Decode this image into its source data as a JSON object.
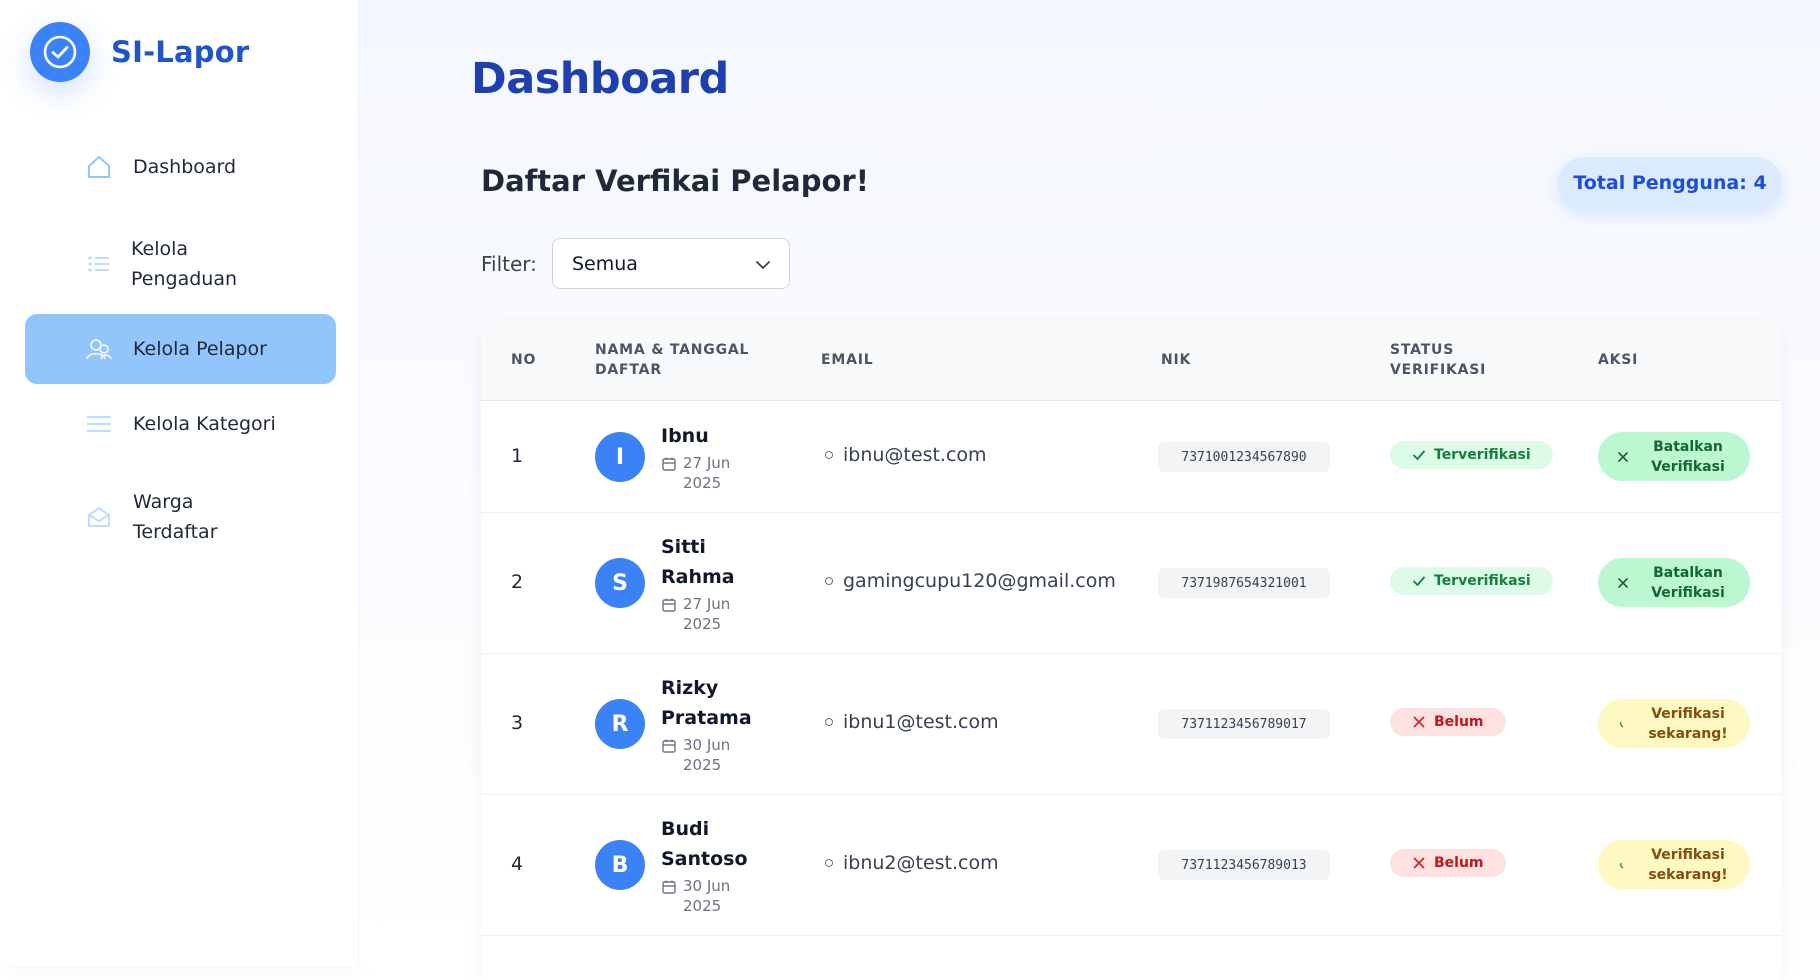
{
  "app": {
    "name": "SI-Lapor"
  },
  "sidebar": {
    "items": [
      {
        "label": "Dashboard",
        "icon": "home-icon",
        "active": false
      },
      {
        "label": "Kelola\nPengaduan",
        "icon": "list-icon",
        "active": false
      },
      {
        "label": "Kelola Pelapor",
        "icon": "users-icon",
        "active": true
      },
      {
        "label": "Kelola Kategori",
        "icon": "menu-icon",
        "active": false
      },
      {
        "label": "Warga\nTerdaftar",
        "icon": "mail-open-icon",
        "active": false
      }
    ]
  },
  "main": {
    "page_title": "Dashboard",
    "section_title": "Daftar Verfikai Pelapor!",
    "total_badge": "Total Pengguna: 4",
    "filter": {
      "label": "Filter:",
      "value": "Semua"
    },
    "table": {
      "headers": {
        "no": "NO",
        "name": "NAMA & TANGGAL\nDAFTAR",
        "email": "EMAIL",
        "nik": "NIK",
        "status": "STATUS\nVERIFIKASI",
        "action": "AKSI"
      },
      "rows": [
        {
          "no": "1",
          "initial": "I",
          "name": "Ibnu",
          "date": "27 Jun\n2025",
          "email": "ibnu@test.com",
          "nik": "7371001234567890",
          "status": "Terverifikasi",
          "verified": true,
          "action": "Batalkan\nVerifikasi"
        },
        {
          "no": "2",
          "initial": "S",
          "name": "Sitti\nRahma",
          "date": "27 Jun\n2025",
          "email": "gamingcupu120@gmail.com",
          "nik": "7371987654321001",
          "status": "Terverifikasi",
          "verified": true,
          "action": "Batalkan\nVerifikasi"
        },
        {
          "no": "3",
          "initial": "R",
          "name": "Rizky\nPratama",
          "date": "30 Jun\n2025",
          "email": "ibnu1@test.com",
          "nik": "7371123456789017",
          "status": "Belum",
          "verified": false,
          "action": "Verifikasi\nsekarang!"
        },
        {
          "no": "4",
          "initial": "B",
          "name": "Budi\nSantoso",
          "date": "30 Jun\n2025",
          "email": "ibnu2@test.com",
          "nik": "7371123456789013",
          "status": "Belum",
          "verified": false,
          "action": "Verifikasi\nsekarang!"
        }
      ]
    }
  },
  "colors": {
    "brand": "#3b82f6",
    "title": "#1e40af",
    "active_nav": "#93c5fd",
    "verified": "#dcfce7",
    "unverified": "#fee2e2",
    "cancel_action": "#bbf7d0",
    "verify_action": "#fef9c3"
  }
}
